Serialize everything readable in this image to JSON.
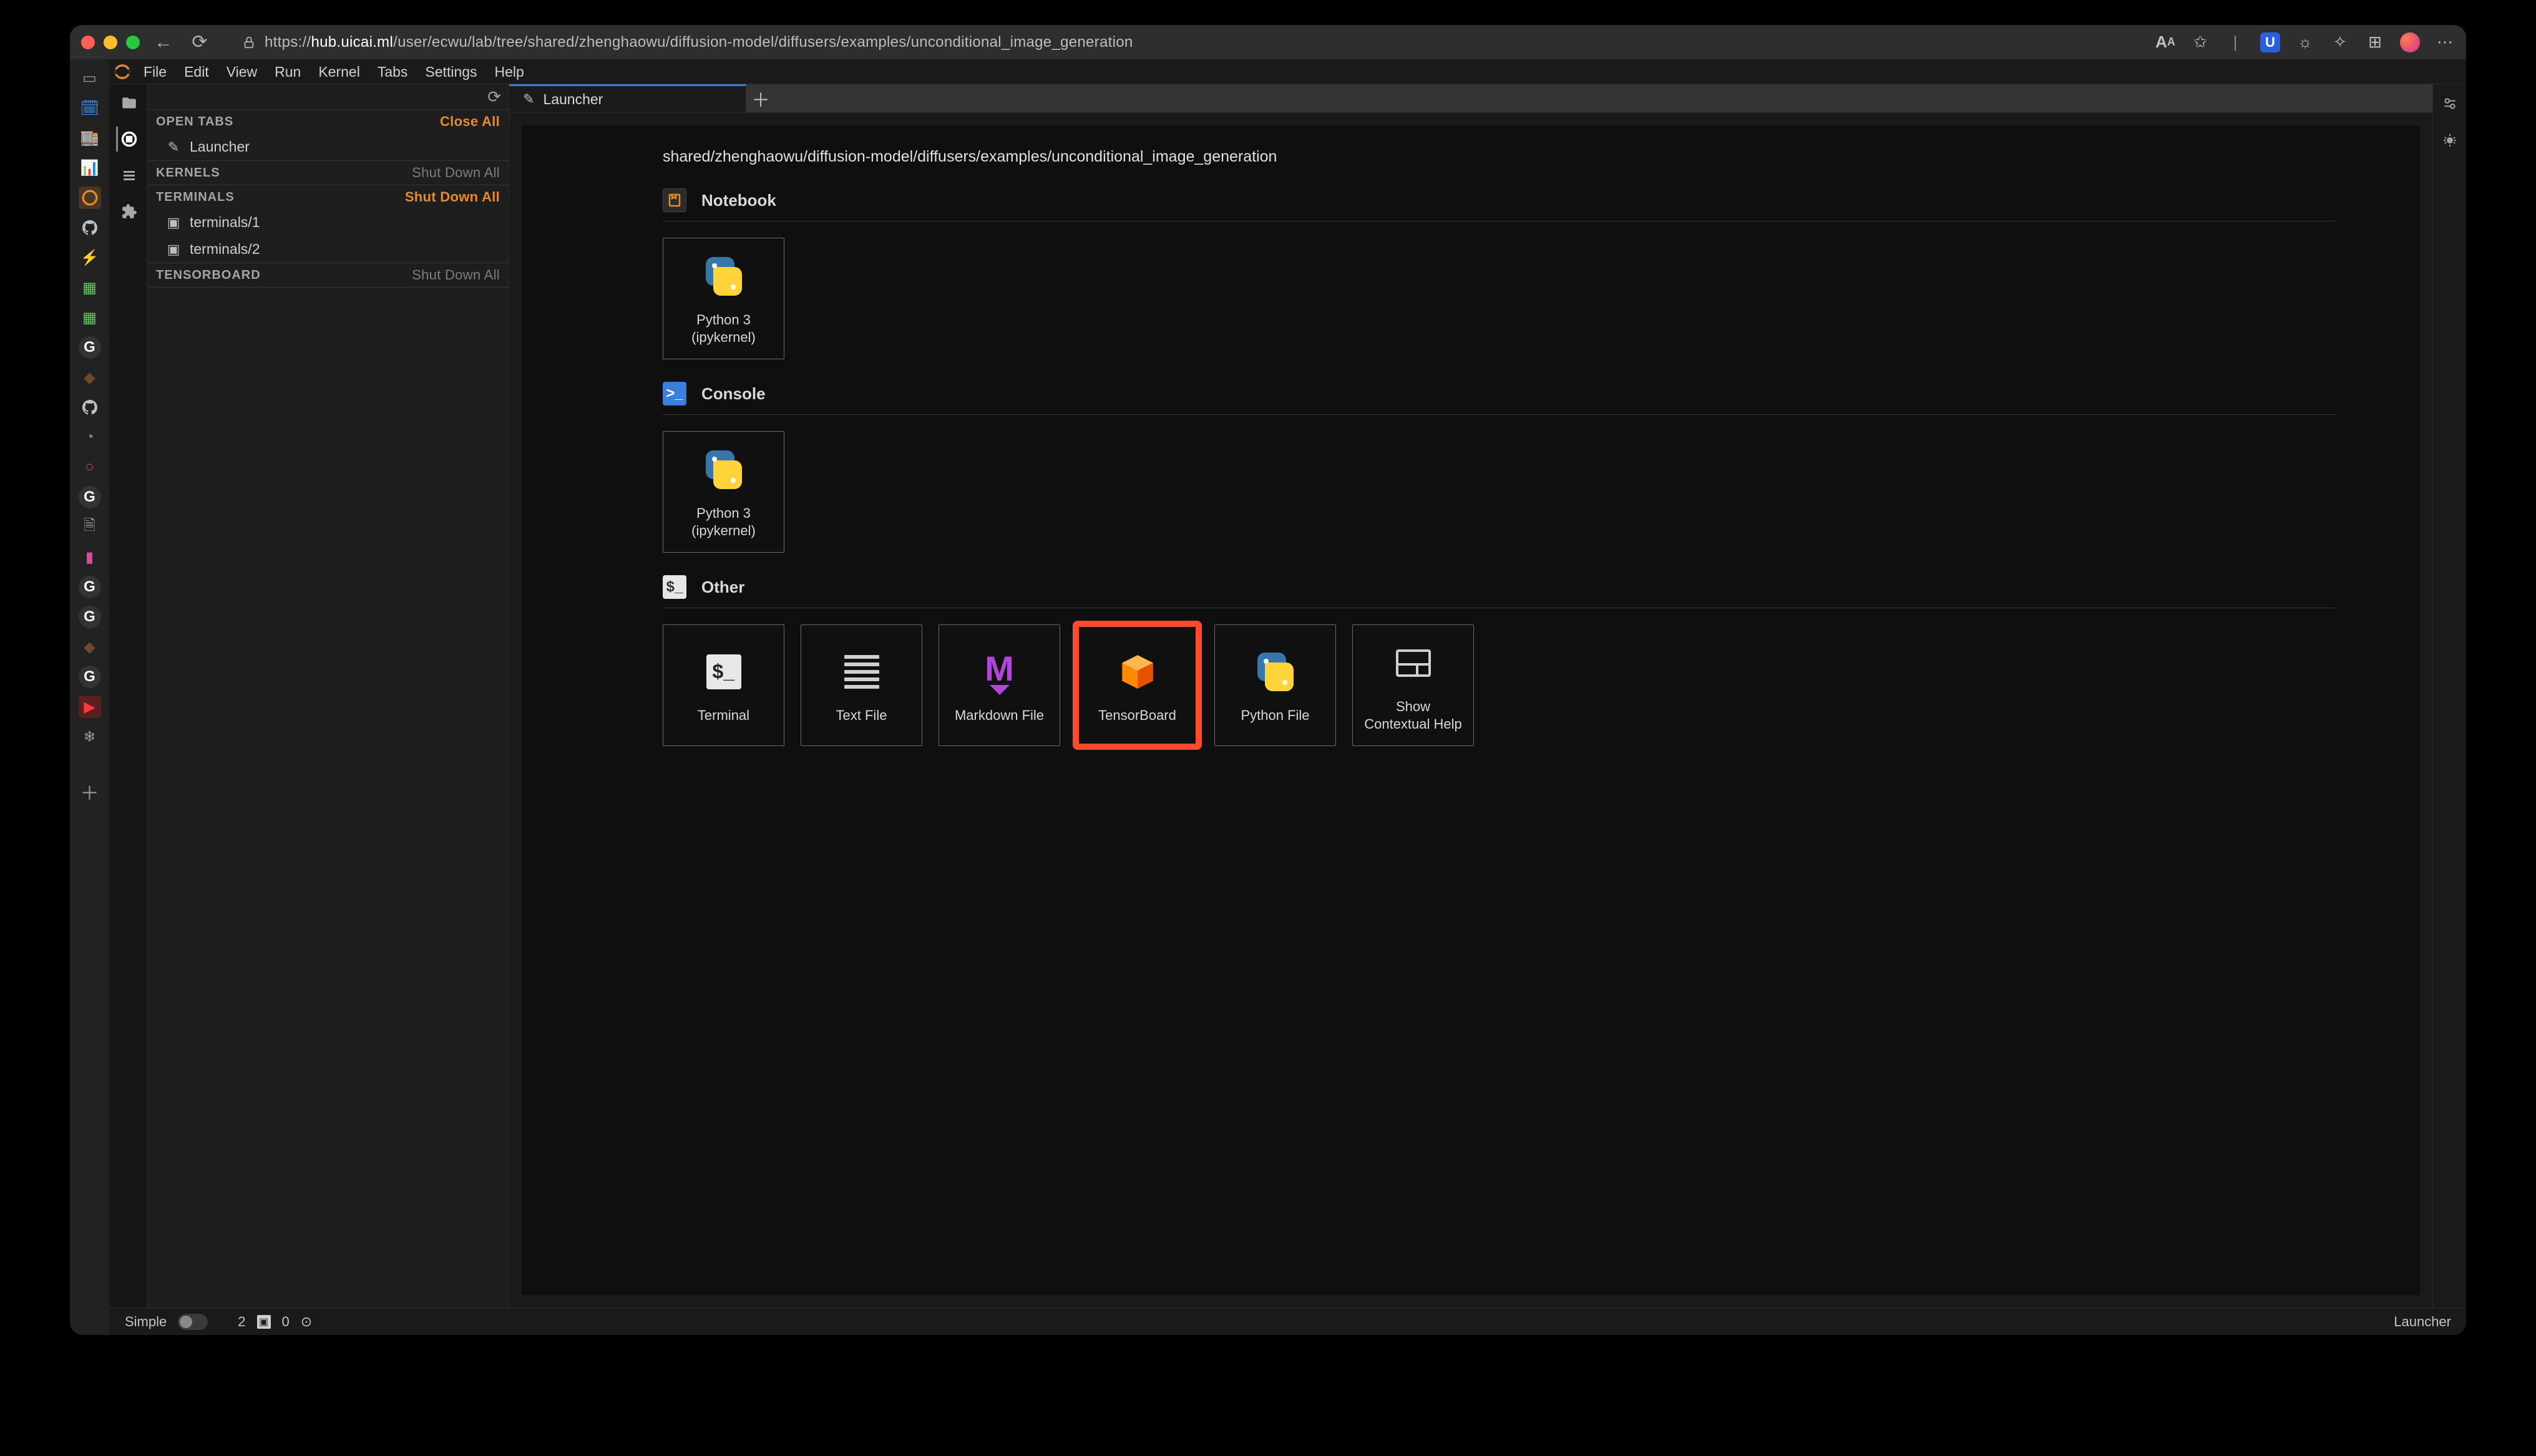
{
  "browser": {
    "url_host": "hub.uicai.ml",
    "url_path": "/user/ecwu/lab/tree/shared/zhenghaowu/diffusion-model/diffusers/examples/unconditional_image_generation",
    "url_prefix": "https://"
  },
  "menubar": [
    "File",
    "Edit",
    "View",
    "Run",
    "Kernel",
    "Tabs",
    "Settings",
    "Help"
  ],
  "left_panel": {
    "open_tabs_label": "OPEN TABS",
    "close_all": "Close All",
    "open_tabs": [
      {
        "icon": "launch",
        "label": "Launcher"
      }
    ],
    "kernels_label": "KERNELS",
    "kernels_action": "Shut Down All",
    "terminals_label": "TERMINALS",
    "terminals_action": "Shut Down All",
    "terminals": [
      {
        "label": "terminals/1"
      },
      {
        "label": "terminals/2"
      }
    ],
    "tensorboard_label": "TENSORBOARD",
    "tensorboard_action": "Shut Down All"
  },
  "tab": {
    "label": "Launcher"
  },
  "launcher": {
    "path": "shared/zhenghaowu/diffusion-model/diffusers/examples/unconditional_image_generation",
    "sections": {
      "notebook": {
        "title": "Notebook",
        "cards": [
          {
            "label": "Python 3\n(ipykernel)",
            "icon": "python"
          }
        ]
      },
      "console": {
        "title": "Console",
        "cards": [
          {
            "label": "Python 3\n(ipykernel)",
            "icon": "python"
          }
        ]
      },
      "other": {
        "title": "Other",
        "badge": "$_",
        "cards": [
          {
            "label": "Terminal",
            "icon": "terminal"
          },
          {
            "label": "Text File",
            "icon": "text"
          },
          {
            "label": "Markdown File",
            "icon": "markdown"
          },
          {
            "label": "TensorBoard",
            "icon": "tensorboard",
            "highlight": true
          },
          {
            "label": "Python File",
            "icon": "python"
          },
          {
            "label": "Show\nContextual Help",
            "icon": "context"
          }
        ]
      }
    }
  },
  "statusbar": {
    "simple": "Simple",
    "terminals_count": "2",
    "kernels_count": "0",
    "right": "Launcher"
  },
  "titlebar_ext": {
    "aA": "A",
    "shield": "U"
  }
}
